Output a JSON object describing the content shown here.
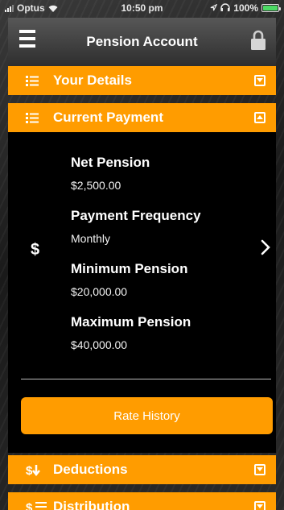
{
  "status_bar": {
    "carrier": "Optus",
    "time": "10:50 pm",
    "battery": "100%",
    "battery_color": "#4cd964"
  },
  "navbar": {
    "title": "Pension Account",
    "menu_icon": "hamburger-icon",
    "lock_icon": "lock-icon"
  },
  "accordion": [
    {
      "label": "Your Details",
      "icon": "list-icon",
      "expanded": false
    },
    {
      "label": "Current Payment",
      "icon": "list-icon",
      "expanded": true
    },
    {
      "label": "Deductions",
      "icon": "dollar-down-icon",
      "expanded": false
    },
    {
      "label": "Distribution",
      "icon": "dollar-list-icon",
      "expanded": false
    }
  ],
  "current_payment": {
    "currency_symbol": "$",
    "fields": [
      {
        "title": "Net Pension",
        "value": "$2,500.00"
      },
      {
        "title": "Payment Frequency",
        "value": "Monthly"
      },
      {
        "title": "Minimum Pension",
        "value": "$20,000.00"
      },
      {
        "title": "Maximum Pension",
        "value": "$40,000.00"
      }
    ],
    "rate_history_label": "Rate History"
  },
  "colors": {
    "accent": "#ff9c00",
    "panel": "#000000"
  }
}
